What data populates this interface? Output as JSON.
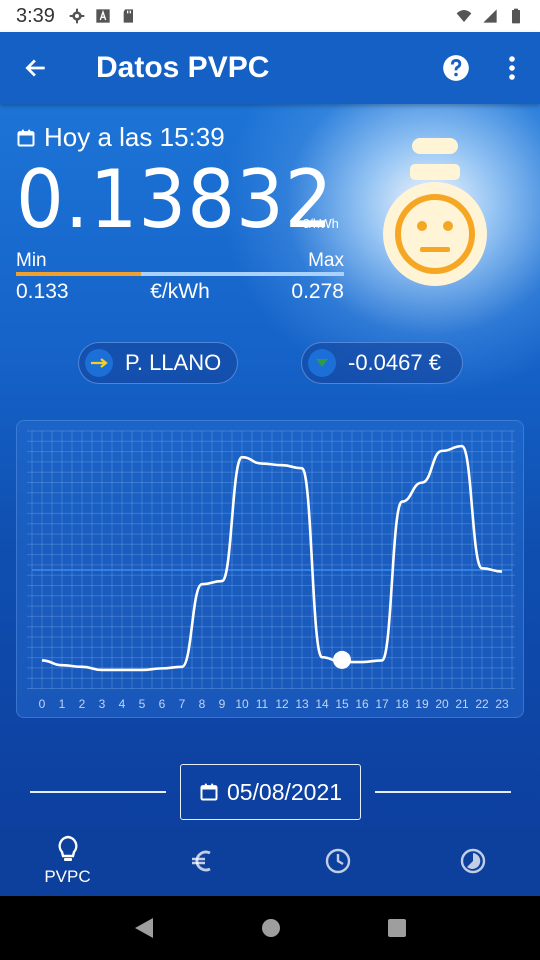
{
  "status_bar": {
    "time": "3:39"
  },
  "app_bar": {
    "title": "Datos PVPC"
  },
  "price": {
    "date_label": "Hoy a las 15:39",
    "value": "0.13832",
    "unit": "€/kWh",
    "min_label": "Min",
    "max_label": "Max",
    "min_value": "0.133",
    "max_value": "0.278",
    "range_unit": "€/kWh",
    "current_fraction": 0.38
  },
  "colors": {
    "accent_orange": "#f0a030",
    "face_color": "#f5a623",
    "down_green": "#2e9a4a",
    "arrow_yellow": "#f5d020"
  },
  "pills": {
    "tariff": {
      "label": "P. LLANO",
      "icon": "arrow-right-icon"
    },
    "diff": {
      "label": "-0.0467 €",
      "icon": "triangle-down-icon"
    }
  },
  "chart_data": {
    "type": "line",
    "x": [
      0,
      1,
      2,
      3,
      4,
      5,
      6,
      7,
      8,
      9,
      10,
      11,
      12,
      13,
      14,
      15,
      16,
      17,
      18,
      19,
      20,
      21,
      22,
      23
    ],
    "series": [
      {
        "values": [
          0.138,
          0.135,
          0.134,
          0.132,
          0.132,
          0.132,
          0.133,
          0.134,
          0.186,
          0.188,
          0.266,
          0.262,
          0.261,
          0.259,
          0.14,
          0.137,
          0.137,
          0.138,
          0.238,
          0.25,
          0.27,
          0.273,
          0.196,
          0.194
        ]
      }
    ],
    "current_hour": 15,
    "current_value": 0.13832,
    "reference_line": 0.195,
    "xlabel": "",
    "ylabel": "",
    "grid": true
  },
  "date_selector": {
    "date": "05/08/2021"
  },
  "bottom_nav": [
    {
      "label": "PVPC",
      "icon": "lightbulb-icon",
      "active": true
    },
    {
      "label": "",
      "icon": "euro-icon",
      "active": false
    },
    {
      "label": "",
      "icon": "clock-icon",
      "active": false
    },
    {
      "label": "",
      "icon": "pie-icon",
      "active": false
    }
  ]
}
